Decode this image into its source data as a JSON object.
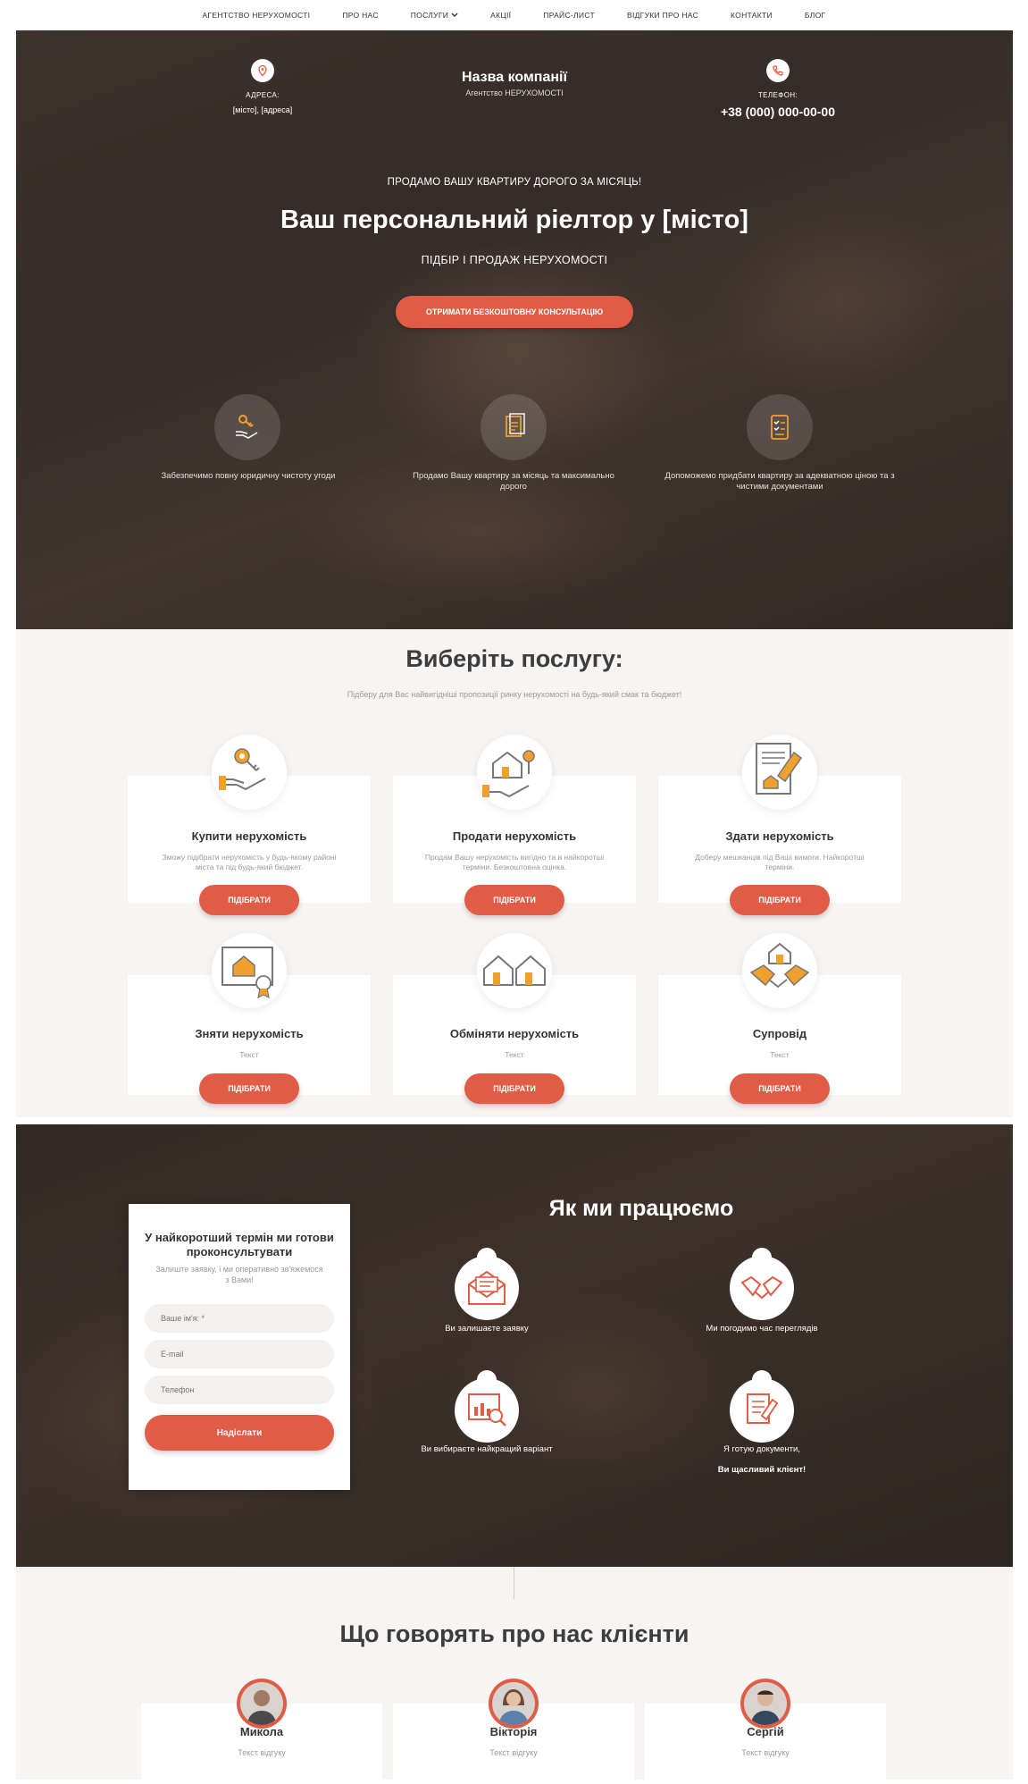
{
  "nav": {
    "items": [
      {
        "label": "АГЕНТСТВО НЕРУХОМОСТІ"
      },
      {
        "label": "ПРО НАС"
      },
      {
        "label": "ПОСЛУГИ"
      },
      {
        "label": "АКЦІЇ"
      },
      {
        "label": "ПРАЙС-ЛИСТ"
      },
      {
        "label": "ВІДГУКИ ПРО НАС"
      },
      {
        "label": "КОНТАКТИ"
      },
      {
        "label": "БЛОГ"
      }
    ]
  },
  "hero": {
    "address_label": "АДРЕСА:",
    "address_value": "[місто], [адреса]",
    "company_name": "Назва компанії",
    "company_sub": "Агентство НЕРУХОМОСТІ",
    "phone_label": "ТЕЛЕФОН:",
    "phone_value": "+38 (000) 000-00-00",
    "kicker": "ПРОДАМО ВАШУ КВАРТИРУ ДОРОГО ЗА МІСЯЦЬ!",
    "title": "Ваш персональний ріелтор у [місто]",
    "subtitle": "ПІДБІР І ПРОДАЖ НЕРУХОМОСТІ",
    "cta": "ОТРИМАТИ БЕЗКОШТОВНУ КОНСУЛЬТАЦІЮ",
    "features": [
      {
        "icon": "hand-key-icon",
        "text": "Забезпечимо повну юридичну чистоту угоди"
      },
      {
        "icon": "documents-icon",
        "text": "Продамо Вашу квартиру за місяць та максимально дорого"
      },
      {
        "icon": "checklist-icon",
        "text": "Допоможемо придбати квартиру за адекватною ціною та з чистими документами"
      }
    ]
  },
  "services": {
    "title": "Виберіть послугу:",
    "subtitle": "Підберу для Вас найвигідніші пропозиції ринку нерухомості на будь-який смак та бюджет!",
    "button_label": "ПІДІБРАТИ",
    "cards": [
      {
        "icon": "key-hand-icon",
        "title": "Купити нерухомість",
        "desc": "Зможу підібрати нерухомість у будь-якому районі міста та під будь-який бюджет."
      },
      {
        "icon": "house-hand-icon",
        "title": "Продати нерухомість",
        "desc": "Продам Вашу нерухомість вигідно та в найкоротші терміни. Безкоштовна оцінка."
      },
      {
        "icon": "contract-pen-icon",
        "title": "Здати нерухомість",
        "desc": "Доберу мешканців під Ваші вимоги. Найкоротші терміни."
      },
      {
        "icon": "house-certificate-icon",
        "title": "Зняти нерухомість",
        "desc": "Текст"
      },
      {
        "icon": "two-houses-icon",
        "title": "Обміняти нерухомість",
        "desc": "Текст"
      },
      {
        "icon": "handshake-house-icon",
        "title": "Супровід",
        "desc": "Текст"
      }
    ]
  },
  "how": {
    "title": "Як ми працюємо",
    "form": {
      "title": "У найкоротший термін ми готови проконсультувати",
      "subtitle": "Залиште заявку, і ми оперативно зв'яжемося з Вами!",
      "name_placeholder": "Ваше ім'я: *",
      "email_placeholder": "E-mail",
      "phone_placeholder": "Телефон",
      "submit": "Надіслати"
    },
    "steps": [
      {
        "icon": "envelope-icon",
        "text": "Ви залишаєте заявку"
      },
      {
        "icon": "handshake-icon",
        "text": "Ми погодимо час переглядів"
      },
      {
        "icon": "analytics-icon",
        "text": "Ви вибираєте найкращий варіант"
      },
      {
        "icon": "document-pen-icon",
        "text": "Я готую документи,",
        "text2": "Ви щасливий клієнт!"
      }
    ]
  },
  "testimonials": {
    "title": "Що говорять про нас клієнти",
    "items": [
      {
        "name": "Микола",
        "text": "Текст відгуку"
      },
      {
        "name": "Вікторія",
        "text": "Текст відгуку"
      },
      {
        "name": "Сергій",
        "text": "Текст відгуку"
      }
    ]
  },
  "colors": {
    "accent": "#e05c45",
    "icon_orange": "#f0a02e"
  }
}
